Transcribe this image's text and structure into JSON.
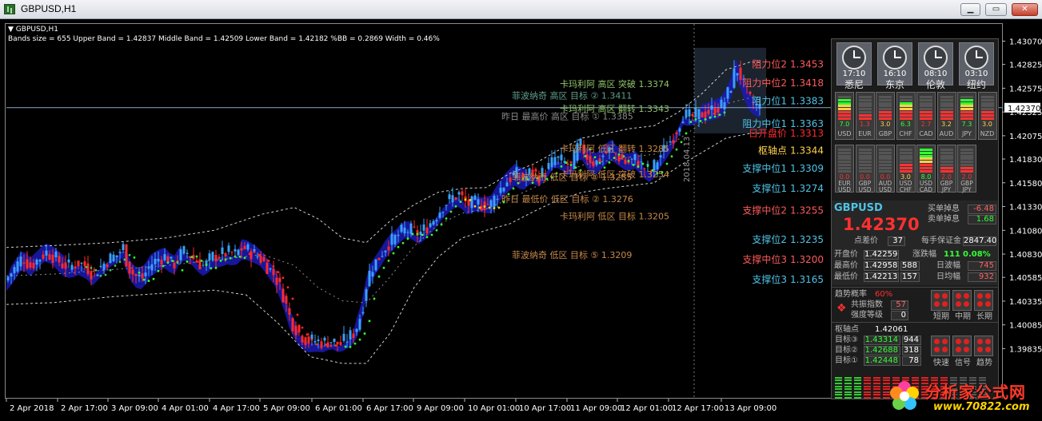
{
  "window": {
    "title": "GBPUSD,H1"
  },
  "indicator": {
    "symbol_label": "GBPUSD,H1",
    "bands_text": "Bands size = 655 Upper Band = 1.42837 Middle Band = 1.42509 Lower Band = 1.42182 %BB = 0.2869 Width = 0.46%"
  },
  "chart_data": {
    "type": "candlestick",
    "symbol": "GBPUSD",
    "timeframe": "H1",
    "ylim": [
      1.3962,
      1.4315
    ],
    "y_ticks": [
      "1.43070",
      "1.42825",
      "1.42575",
      "1.42325",
      "1.42075",
      "1.41830",
      "1.41580",
      "1.41330",
      "1.41080",
      "1.40830",
      "1.40585",
      "1.40335",
      "1.40085",
      "1.39835"
    ],
    "x_ticks": [
      "2 Apr 2018",
      "2 Apr 17:00",
      "3 Apr 09:00",
      "4 Apr 01:00",
      "4 Apr 17:00",
      "5 Apr 09:00",
      "6 Apr 01:00",
      "6 Apr 17:00",
      "9 Apr 09:00",
      "10 Apr 01:00",
      "10 Apr 17:00",
      "11 Apr 09:00",
      "12 Apr 01:00",
      "12 Apr 17:00",
      "13 Apr 09:00"
    ],
    "current_price": "1.42370",
    "vertical_date_label": "2018.04.13",
    "grid": false,
    "close_path": [
      [
        0,
        1.4057
      ],
      [
        10,
        1.4068
      ],
      [
        20,
        1.408
      ],
      [
        30,
        1.407
      ],
      [
        40,
        1.4078
      ],
      [
        50,
        1.4085
      ],
      [
        60,
        1.408
      ],
      [
        70,
        1.4072
      ],
      [
        80,
        1.407
      ],
      [
        90,
        1.4074
      ],
      [
        100,
        1.407
      ],
      [
        108,
        1.4062
      ],
      [
        118,
        1.407
      ],
      [
        128,
        1.4078
      ],
      [
        138,
        1.4082
      ],
      [
        146,
        1.409
      ],
      [
        152,
        1.407
      ],
      [
        160,
        1.406
      ],
      [
        170,
        1.4058
      ],
      [
        180,
        1.4072
      ],
      [
        190,
        1.4078
      ],
      [
        200,
        1.4081
      ],
      [
        208,
        1.407
      ],
      [
        216,
        1.4082
      ],
      [
        224,
        1.4086
      ],
      [
        232,
        1.408
      ],
      [
        240,
        1.4074
      ],
      [
        248,
        1.407
      ],
      [
        256,
        1.408
      ],
      [
        266,
        1.4082
      ],
      [
        276,
        1.4085
      ],
      [
        286,
        1.4083
      ],
      [
        296,
        1.409
      ],
      [
        306,
        1.4085
      ],
      [
        316,
        1.408
      ],
      [
        326,
        1.407
      ],
      [
        336,
        1.406
      ],
      [
        346,
        1.404
      ],
      [
        356,
        1.4012
      ],
      [
        366,
        1.4
      ],
      [
        376,
        1.3992
      ],
      [
        386,
        1.3992
      ],
      [
        396,
        1.399
      ],
      [
        406,
        1.3992
      ],
      [
        416,
        1.3988
      ],
      [
        426,
        1.3994
      ],
      [
        434,
        1.4
      ],
      [
        440,
        1.401
      ],
      [
        446,
        1.403
      ],
      [
        452,
        1.406
      ],
      [
        458,
        1.407
      ],
      [
        466,
        1.408
      ],
      [
        476,
        1.4093
      ],
      [
        486,
        1.41
      ],
      [
        496,
        1.4108
      ],
      [
        506,
        1.4108
      ],
      [
        516,
        1.4104
      ],
      [
        526,
        1.4112
      ],
      [
        536,
        1.4122
      ],
      [
        546,
        1.4134
      ],
      [
        556,
        1.4142
      ],
      [
        566,
        1.4146
      ],
      [
        576,
        1.4135
      ],
      [
        586,
        1.4137
      ],
      [
        596,
        1.4135
      ],
      [
        606,
        1.4136
      ],
      [
        616,
        1.415
      ],
      [
        626,
        1.416
      ],
      [
        636,
        1.4168
      ],
      [
        646,
        1.4162
      ],
      [
        656,
        1.417
      ],
      [
        666,
        1.4165
      ],
      [
        676,
        1.4172
      ],
      [
        686,
        1.4184
      ],
      [
        696,
        1.418
      ],
      [
        706,
        1.4175
      ],
      [
        716,
        1.42
      ],
      [
        726,
        1.4186
      ],
      [
        736,
        1.4178
      ],
      [
        746,
        1.4187
      ],
      [
        756,
        1.4193
      ],
      [
        766,
        1.4185
      ],
      [
        776,
        1.4178
      ],
      [
        786,
        1.4183
      ],
      [
        796,
        1.4175
      ],
      [
        806,
        1.417
      ],
      [
        816,
        1.4185
      ],
      [
        826,
        1.4197
      ],
      [
        836,
        1.421
      ],
      [
        846,
        1.423
      ],
      [
        856,
        1.4227
      ],
      [
        866,
        1.423
      ],
      [
        876,
        1.4232
      ],
      [
        886,
        1.4236
      ],
      [
        896,
        1.424
      ],
      [
        906,
        1.426
      ],
      [
        912,
        1.428
      ],
      [
        918,
        1.427
      ],
      [
        924,
        1.4255
      ],
      [
        930,
        1.4245
      ],
      [
        936,
        1.424
      ],
      [
        942,
        1.4237
      ]
    ],
    "upper_band": [
      [
        0,
        1.409
      ],
      [
        60,
        1.4092
      ],
      [
        130,
        1.4095
      ],
      [
        200,
        1.41
      ],
      [
        260,
        1.4108
      ],
      [
        320,
        1.4125
      ],
      [
        360,
        1.4132
      ],
      [
        390,
        1.412
      ],
      [
        420,
        1.41
      ],
      [
        450,
        1.4095
      ],
      [
        480,
        1.4118
      ],
      [
        510,
        1.4135
      ],
      [
        540,
        1.4148
      ],
      [
        570,
        1.4152
      ],
      [
        600,
        1.4153
      ],
      [
        630,
        1.4168
      ],
      [
        660,
        1.4178
      ],
      [
        690,
        1.4192
      ],
      [
        720,
        1.4205
      ],
      [
        750,
        1.421
      ],
      [
        780,
        1.4215
      ],
      [
        810,
        1.4218
      ],
      [
        840,
        1.4232
      ],
      [
        870,
        1.4252
      ],
      [
        900,
        1.4277
      ],
      [
        930,
        1.4285
      ],
      [
        942,
        1.4285
      ]
    ],
    "lower_band": [
      [
        0,
        1.403
      ],
      [
        60,
        1.4032
      ],
      [
        130,
        1.4038
      ],
      [
        200,
        1.4042
      ],
      [
        260,
        1.4045
      ],
      [
        300,
        1.404
      ],
      [
        340,
        1.401
      ],
      [
        380,
        1.3975
      ],
      [
        420,
        1.3968
      ],
      [
        450,
        1.3968
      ],
      [
        480,
        1.4
      ],
      [
        510,
        1.4048
      ],
      [
        540,
        1.408
      ],
      [
        570,
        1.41
      ],
      [
        600,
        1.4108
      ],
      [
        630,
        1.4115
      ],
      [
        660,
        1.4128
      ],
      [
        690,
        1.414
      ],
      [
        720,
        1.4148
      ],
      [
        750,
        1.4152
      ],
      [
        780,
        1.4155
      ],
      [
        810,
        1.4158
      ],
      [
        840,
        1.4175
      ],
      [
        870,
        1.419
      ],
      [
        900,
        1.4205
      ],
      [
        930,
        1.421
      ],
      [
        942,
        1.421
      ]
    ],
    "levels": [
      {
        "label": "阻力位2",
        "value": "1.3453",
        "price": 1.42825,
        "color": "#ff5a5a"
      },
      {
        "label": "阻力中位2",
        "value": "1.3418",
        "price": 1.4263,
        "color": "#ff5a5a"
      },
      {
        "label": "阻力位1",
        "value": "1.3383",
        "price": 1.4244,
        "color": "#4fc3e6"
      },
      {
        "label": "阻力中位1",
        "value": "1.3363",
        "price": 1.422,
        "color": "#4fc3e6"
      },
      {
        "label": "日开盘价",
        "value": "1.3313",
        "price": 1.421,
        "color": "#ff2a2a"
      },
      {
        "label": "枢轴点",
        "value": "1.3344",
        "price": 1.4192,
        "color": "#ffd24a"
      },
      {
        "label": "支撑中位1",
        "value": "1.3309",
        "price": 1.4173,
        "color": "#4fc3e6"
      },
      {
        "label": "支撑位1",
        "value": "1.3274",
        "price": 1.4152,
        "color": "#4fc3e6"
      },
      {
        "label": "支撑中位2",
        "value": "1.3255",
        "price": 1.4129,
        "color": "#ff5a5a"
      },
      {
        "label": "支撑位2",
        "value": "1.3235",
        "price": 1.4098,
        "color": "#4fc3e6"
      },
      {
        "label": "支撑中位3",
        "value": "1.3200",
        "price": 1.4077,
        "color": "#ff5a5a"
      },
      {
        "label": "支撑位3",
        "value": "1.3165",
        "price": 1.4056,
        "color": "#4fc3e6"
      }
    ],
    "annotations": [
      {
        "text": "卡玛利阿 高区 突破  1.3374",
        "color": "#8fc36b",
        "price": 1.4262,
        "x": 700
      },
      {
        "text": "菲波纳奇 高区 目标 ②  1.3411",
        "color": "#5fa08a",
        "price": 1.425,
        "x": 640
      },
      {
        "text": "卡玛利阿 高区 翻转  1.3343",
        "color": "#8fc36b",
        "price": 1.4236,
        "x": 700
      },
      {
        "text": "昨日 最高价 高区 目标 ①  1.3385",
        "color": "#8a8a8a",
        "price": 1.4228,
        "x": 627
      },
      {
        "text": "卡玛利阿 低区 翻转  1.3285",
        "color": "#c98a4a",
        "price": 1.4194,
        "x": 700
      },
      {
        "text": "卡玛利阿 低区 突破  1.3254",
        "color": "#c98a4a",
        "price": 1.4167,
        "x": 700
      },
      {
        "text": "菲波纳奇 低区 目标 ③  1.3285",
        "color": "#c98a4a",
        "price": 1.4164,
        "x": 640
      },
      {
        "text": "昨日 最低价 低区 目标 ②  1.3276",
        "color": "#c98a4a",
        "price": 1.4141,
        "x": 627
      },
      {
        "text": "卡玛利阿 低区 目标  1.3205",
        "color": "#c98a4a",
        "price": 1.4123,
        "x": 700
      },
      {
        "text": "菲波纳奇 低区 目标 ⑤  1.3209",
        "color": "#c98a4a",
        "price": 1.4082,
        "x": 640
      }
    ]
  },
  "panel": {
    "clocks": [
      {
        "time": "17:10",
        "city": "悉尼"
      },
      {
        "time": "16:10",
        "city": "东京"
      },
      {
        "time": "08:10",
        "city": "伦敦"
      },
      {
        "time": "03:10",
        "city": "纽约"
      }
    ],
    "currency_row1": [
      {
        "name": "USD",
        "value": "7.0",
        "color": "#33ff33",
        "level": 7
      },
      {
        "name": "EUR",
        "value": "1.3",
        "color": "#ff3333",
        "level": 2
      },
      {
        "name": "GBP",
        "value": "3.0",
        "color": "#ffd24a",
        "level": 3
      },
      {
        "name": "CHF",
        "value": "6.3",
        "color": "#33ff33",
        "level": 6
      },
      {
        "name": "CAD",
        "value": "2.7",
        "color": "#ff3333",
        "level": 3
      },
      {
        "name": "AUD",
        "value": "3.2",
        "color": "#ffd24a",
        "level": 3
      },
      {
        "name": "JPY",
        "value": "7.3",
        "color": "#33ff33",
        "level": 7
      },
      {
        "name": "NZD",
        "value": "3.0",
        "color": "#ffd24a",
        "level": 3
      }
    ],
    "currency_row2": [
      {
        "name": "EUR USD",
        "value": "0.0",
        "color": "#ff3333",
        "level": 0
      },
      {
        "name": "GBP USD",
        "value": "0.0",
        "color": "#ff3333",
        "level": 0
      },
      {
        "name": "AUD USD",
        "value": "0.0",
        "color": "#ff3333",
        "level": 0
      },
      {
        "name": "USD CHF",
        "value": "3.0",
        "color": "#ffd24a",
        "level": 3
      },
      {
        "name": "USD CAD",
        "value": "8.0",
        "color": "#33ff33",
        "level": 8
      },
      {
        "name": "GBP JPY",
        "value": "2.0",
        "color": "#ff3333",
        "level": 2
      },
      {
        "name": "GBP JPY",
        "value": "2.0",
        "color": "#ff3333",
        "level": 2
      }
    ],
    "symbol": "GBPUSD",
    "price": "1.42370",
    "buy_swap_label": "买单掉息",
    "buy_swap": "-6.48",
    "sell_swap_label": "卖单掉息",
    "sell_swap": "1.68",
    "spread_label": "点差价",
    "spread": "37",
    "margin_label": "每手保证金",
    "margin": "2847.40",
    "open_label": "开盘价",
    "open": "1.42259",
    "change_label": "涨跌幅",
    "change_pts": "111",
    "change_pct": "0.08%",
    "high_label": "最高价",
    "high": "1.42958",
    "high_pts": "588",
    "day_range_label": "日波幅",
    "day_range": "745",
    "low_label": "最低价",
    "low": "1.42213",
    "low_pts": "157",
    "week_range_label": "日均幅",
    "week_range": "932",
    "trend_label": "趋势概率",
    "trend_value": "60%",
    "resonance_label": "共振指数",
    "resonance": "57",
    "strength_label": "强度等级",
    "strength": "0",
    "short_label": "短期",
    "mid_label": "中期",
    "long_label": "长期",
    "pivot_label": "枢轴点",
    "pivot": "1.42061",
    "targets": [
      {
        "label": "目标③",
        "value": "1.43314",
        "pts": "944"
      },
      {
        "label": "目标②",
        "value": "1.42688",
        "pts": "318"
      },
      {
        "label": "目标①",
        "value": "1.42448",
        "pts": "78"
      }
    ],
    "fast_label": "快速",
    "signal_label": "信号",
    "trend2_label": "趋势"
  },
  "watermark": {
    "brand": "分析家公式网",
    "url": "www.70822.com"
  }
}
